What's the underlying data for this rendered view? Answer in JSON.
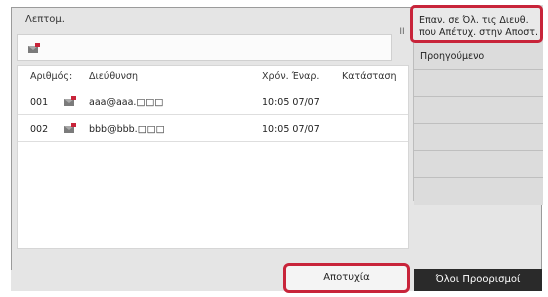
{
  "title": "Λεπτομ.",
  "table": {
    "headers": {
      "number": "Αριθμός:",
      "address": "Διεύθυνση",
      "start_time": "Χρόν. Έναρ.",
      "status": "Κατάσταση"
    },
    "rows": [
      {
        "number": "001",
        "address": "aaa@aaa.□□□",
        "start_time": "10:05 07/07",
        "status": ""
      },
      {
        "number": "002",
        "address": "bbb@bbb.□□□",
        "start_time": "10:05 07/07",
        "status": ""
      }
    ]
  },
  "scroll_handle_glyph": "II",
  "menu": {
    "items": [
      "Επαν. σε Όλ. τις Διευθ.\nπου Απέτυχ. στην Αποστ.",
      "Προηγούμενο",
      "",
      "",
      "",
      "",
      ""
    ]
  },
  "buttons": {
    "failed": "Αποτυχία",
    "all_destinations": "Όλοι Προορισμοί"
  },
  "colors": {
    "highlight": "#c8243a",
    "dark_button": "#2a2a2a",
    "panel": "#e5e5e5"
  },
  "icons": {
    "header_icon": "email-fax-icon",
    "row_icon": "email-fax-icon"
  }
}
